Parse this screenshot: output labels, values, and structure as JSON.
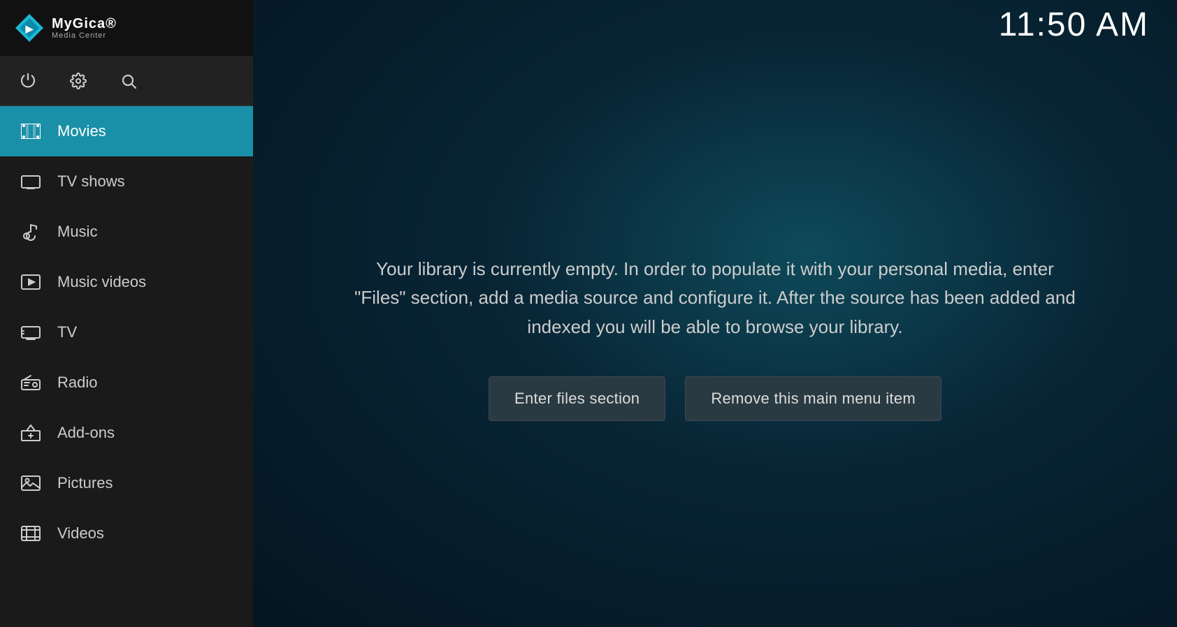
{
  "app": {
    "brand": "MyGica®",
    "subtitle": "Media Center",
    "clock": "11:50 AM"
  },
  "toolbar": {
    "power_icon": "⏻",
    "settings_icon": "⚙",
    "search_icon": "🔍"
  },
  "nav": {
    "items": [
      {
        "id": "movies",
        "label": "Movies",
        "icon": "🎬",
        "active": true
      },
      {
        "id": "tv-shows",
        "label": "TV shows",
        "icon": "🖥",
        "active": false
      },
      {
        "id": "music",
        "label": "Music",
        "icon": "🎧",
        "active": false
      },
      {
        "id": "music-videos",
        "label": "Music videos",
        "icon": "🎵",
        "active": false
      },
      {
        "id": "tv",
        "label": "TV",
        "icon": "📺",
        "active": false
      },
      {
        "id": "radio",
        "label": "Radio",
        "icon": "📻",
        "active": false
      },
      {
        "id": "add-ons",
        "label": "Add-ons",
        "icon": "📦",
        "active": false
      },
      {
        "id": "pictures",
        "label": "Pictures",
        "icon": "🖼",
        "active": false
      },
      {
        "id": "videos",
        "label": "Videos",
        "icon": "📽",
        "active": false
      }
    ]
  },
  "main": {
    "empty_message": "Your library is currently empty. In order to populate it with your personal media, enter \"Files\" section, add a media source and configure it. After the source has been added and indexed you will be able to browse your library.",
    "btn_enter_files": "Enter files section",
    "btn_remove_item": "Remove this main menu item"
  }
}
